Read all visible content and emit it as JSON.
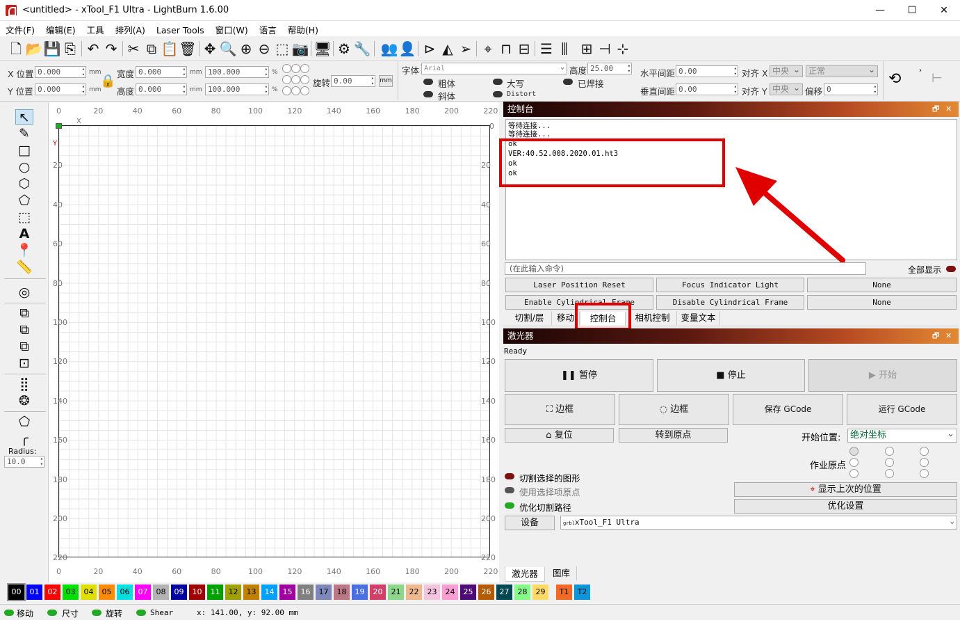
{
  "window": {
    "title": "<untitled> - xTool_F1 Ultra - LightBurn 1.6.00",
    "min": "—",
    "max": "☐",
    "close": "✕"
  },
  "menu": [
    "文件(F)",
    "编辑(E)",
    "工具",
    "排列(A)",
    "Laser Tools",
    "窗口(W)",
    "语言",
    "帮助(H)"
  ],
  "toolbar_icons": [
    "new-file-icon",
    "open-folder-icon",
    "save-icon",
    "export-icon",
    "undo-icon",
    "redo-icon",
    "cut-icon",
    "copy-icon",
    "paste-icon",
    "delete-icon",
    "move-icon",
    "zoom-icon",
    "zoom-in-icon",
    "zoom-out-icon",
    "zoom-frame-icon",
    "camera-icon",
    "monitor-icon",
    "settings-icon",
    "tools-icon",
    "group-icon",
    "user-icon",
    "flip-h-icon",
    "mirror-icon",
    "send-icon",
    "target-icon",
    "nudge-icon",
    "align-icon",
    "distribute-h-icon",
    "distribute-v-icon",
    "dock-icon",
    "center-icon"
  ],
  "props": {
    "xpos_label": "X 位置",
    "xpos": "0.000",
    "ypos_label": "Y 位置",
    "ypos": "0.000",
    "unit": "mm",
    "width_label": "宽度",
    "width": "0.000",
    "height_label": "高度",
    "height": "0.000",
    "scale_w": "100.000",
    "scale_h": "100.000",
    "pct": "%",
    "rotate_label": "旋转",
    "rotate": "0.00",
    "mm_btn": "mm",
    "font_label": "字体",
    "font": "Arial",
    "fheight_label": "高度",
    "fheight": "25.00",
    "bold": "粗体",
    "italic": "斜体",
    "upper": "大写",
    "welded": "已焊接",
    "distort": "Distort",
    "hspace_label": "水平间距",
    "hspace": "0.00",
    "vspace_label": "垂直间距",
    "vspace": "0.00",
    "alignx_label": "对齐 X",
    "alignx": "中央",
    "aligny_label": "对齐 Y",
    "aligny": "中央",
    "normal": "正常",
    "offset_label": "偏移",
    "offset": "0"
  },
  "ruler": {
    "top": [
      "0",
      "20",
      "40",
      "60",
      "80",
      "100",
      "120",
      "140",
      "160",
      "180",
      "200",
      "220"
    ],
    "left": [
      "0",
      "20",
      "40",
      "60",
      "80",
      "100",
      "120",
      "140",
      "160",
      "180",
      "200",
      "220"
    ],
    "x": "X",
    "y": "Y"
  },
  "toolbox": {
    "radius_label": "Radius:",
    "radius": "10.0"
  },
  "console": {
    "title": "控制台",
    "lines": [
      "等待连接...",
      "等待连接...",
      "ok",
      "VER:40.52.008.2020.01.ht3",
      "ok",
      "ok"
    ],
    "input_placeholder": "(在此输入命令)",
    "show_all": "全部显示",
    "macros": [
      "Laser Position Reset",
      "Focus Indicator Light",
      "None",
      "Enable Cylindrical Frame",
      "Disable Cylindrical Frame",
      "None"
    ],
    "tabs": [
      "切割/层",
      "移动",
      "控制台",
      "相机控制",
      "变量文本"
    ]
  },
  "laser": {
    "title": "激光器",
    "status": "Ready",
    "pause": "暂停",
    "stop": "停止",
    "start": "开始",
    "frame1": "边框",
    "frame2": "边框",
    "save_gcode": "保存 GCode",
    "run_gcode": "运行 GCode",
    "home": "复位",
    "goto_origin": "转到原点",
    "start_from_label": "开始位置:",
    "start_from": "绝对坐标",
    "job_origin_label": "作业原点",
    "cut_selected": "切割选择的图形",
    "use_selection_origin": "使用选择项原点",
    "optimize_path": "优化切割路径",
    "show_last": "显示上次的位置",
    "optimize_settings": "优化设置",
    "device_label": "设备",
    "device": "xTool_F1 Ultra",
    "device_prefix": "grbl",
    "bottom_tabs": [
      "激光器",
      "图库"
    ]
  },
  "palette": [
    {
      "t": "00",
      "c": "#000000",
      "f": "#ffffff"
    },
    {
      "t": "01",
      "c": "#0000ff",
      "f": "#ffffff"
    },
    {
      "t": "02",
      "c": "#ff0000",
      "f": "#ffffff"
    },
    {
      "t": "03",
      "c": "#00e000",
      "f": "#000000"
    },
    {
      "t": "04",
      "c": "#e0e000",
      "f": "#000000"
    },
    {
      "t": "05",
      "c": "#ff8c00",
      "f": "#000000"
    },
    {
      "t": "06",
      "c": "#00e0e0",
      "f": "#000000"
    },
    {
      "t": "07",
      "c": "#ff00ff",
      "f": "#ffffff"
    },
    {
      "t": "08",
      "c": "#b4b4b4",
      "f": "#000000"
    },
    {
      "t": "09",
      "c": "#0000a0",
      "f": "#ffffff"
    },
    {
      "t": "10",
      "c": "#a00000",
      "f": "#ffffff"
    },
    {
      "t": "11",
      "c": "#00a000",
      "f": "#ffffff"
    },
    {
      "t": "12",
      "c": "#a0a000",
      "f": "#000000"
    },
    {
      "t": "13",
      "c": "#c08000",
      "f": "#000000"
    },
    {
      "t": "14",
      "c": "#00a0ff",
      "f": "#ffffff"
    },
    {
      "t": "15",
      "c": "#a000a0",
      "f": "#ffffff"
    },
    {
      "t": "16",
      "c": "#808080",
      "f": "#ffffff"
    },
    {
      "t": "17",
      "c": "#7d87b9",
      "f": "#000000"
    },
    {
      "t": "18",
      "c": "#bb7784",
      "f": "#000000"
    },
    {
      "t": "19",
      "c": "#4a6fe3",
      "f": "#ffffff"
    },
    {
      "t": "20",
      "c": "#d33f6a",
      "f": "#ffffff"
    },
    {
      "t": "21",
      "c": "#8cd78c",
      "f": "#000000"
    },
    {
      "t": "22",
      "c": "#f0b98d",
      "f": "#000000"
    },
    {
      "t": "23",
      "c": "#f6c4e1",
      "f": "#000000"
    },
    {
      "t": "24",
      "c": "#fa9ed4",
      "f": "#000000"
    },
    {
      "t": "25",
      "c": "#500a78",
      "f": "#ffffff"
    },
    {
      "t": "26",
      "c": "#b45a00",
      "f": "#ffffff"
    },
    {
      "t": "27",
      "c": "#004754",
      "f": "#ffffff"
    },
    {
      "t": "28",
      "c": "#86fa88",
      "f": "#000000"
    },
    {
      "t": "29",
      "c": "#ffdb66",
      "f": "#000000"
    },
    {
      "t": "T1",
      "c": "#f36926",
      "f": "#000000"
    },
    {
      "t": "T2",
      "c": "#0c96d9",
      "f": "#000000"
    }
  ],
  "status": {
    "move": "移动",
    "size": "尺寸",
    "rotate": "旋转",
    "shear": "Shear",
    "coords": "x: 141.00, y: 92.00 mm"
  },
  "colors": {
    "highlight": "#e00000",
    "panel_header_start": "#1a0504",
    "panel_header_end": "#e38a34"
  }
}
